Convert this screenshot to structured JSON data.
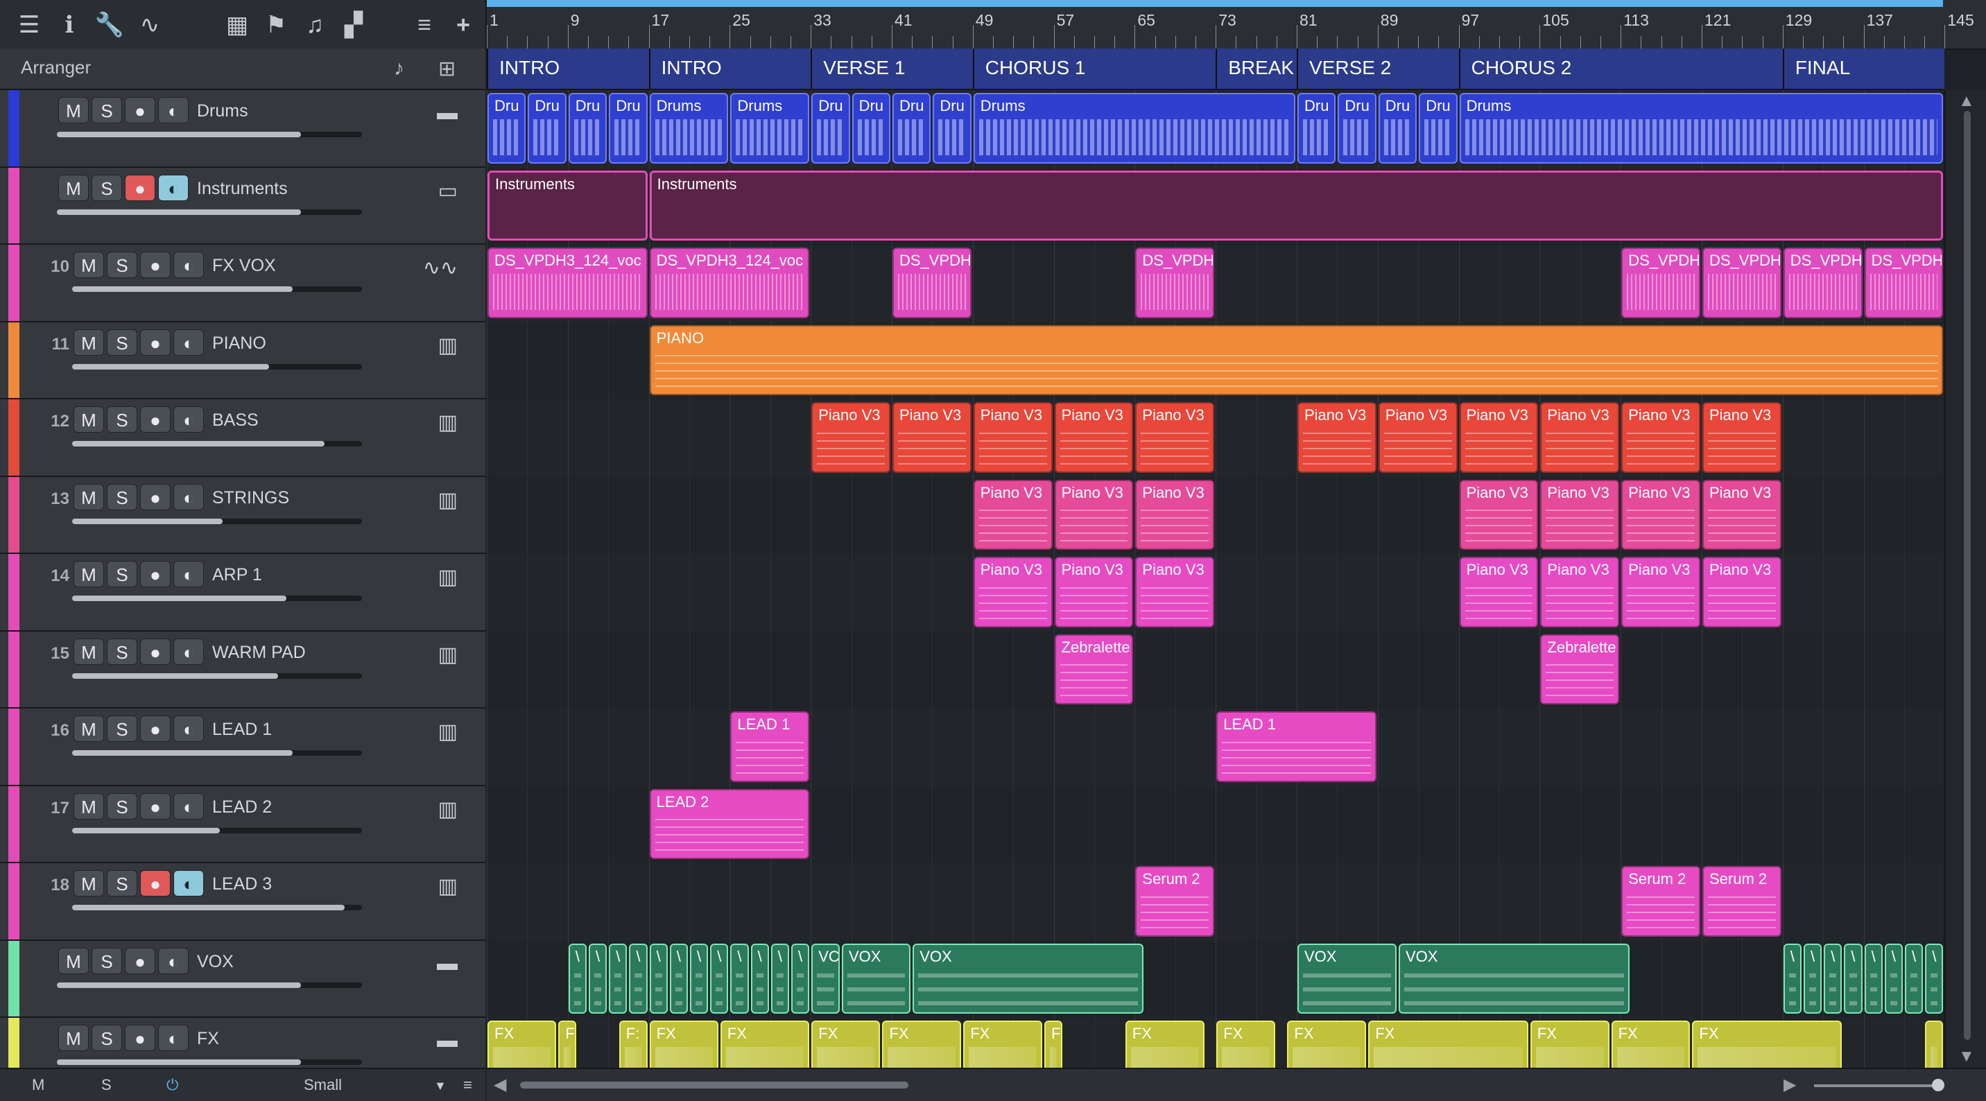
{
  "toolbar": {
    "icons": [
      "menu-icon",
      "info-icon",
      "wrench-icon",
      "automation-icon",
      "grid-icon",
      "flag-icon",
      "score-icon",
      "layout-icon",
      "list-icon",
      "add-icon"
    ]
  },
  "arranger": {
    "title": "Arranger"
  },
  "tracks": [
    {
      "id": "drums",
      "number": "",
      "name": "Drums",
      "color": "#2b3ad6",
      "kind": "folder",
      "rec": false,
      "mon": false,
      "volume": 0.8,
      "icon": "folder-icon"
    },
    {
      "id": "instruments",
      "number": "",
      "name": "Instruments",
      "color": "#e64bb8",
      "kind": "folder",
      "rec": true,
      "mon": true,
      "volume": 0.8,
      "icon": "folder-open-icon"
    },
    {
      "id": "fx-vox",
      "number": "10",
      "name": "FX VOX",
      "color": "#e64bb8",
      "kind": "audio",
      "rec": false,
      "mon": false,
      "volume": 0.76,
      "icon": "waveform-icon"
    },
    {
      "id": "piano",
      "number": "11",
      "name": "PIANO",
      "color": "#f08a3a",
      "kind": "instrument",
      "rec": false,
      "mon": false,
      "volume": 0.68,
      "icon": "keyboard-icon"
    },
    {
      "id": "bass",
      "number": "12",
      "name": "BASS",
      "color": "#e34a3a",
      "kind": "instrument",
      "rec": false,
      "mon": false,
      "volume": 0.87,
      "icon": "keyboard-icon"
    },
    {
      "id": "strings",
      "number": "13",
      "name": "STRINGS",
      "color": "#e64b8f",
      "kind": "instrument",
      "rec": false,
      "mon": false,
      "volume": 0.52,
      "icon": "keyboard-icon"
    },
    {
      "id": "arp-1",
      "number": "14",
      "name": "ARP 1",
      "color": "#e64bb8",
      "kind": "instrument",
      "rec": false,
      "mon": false,
      "volume": 0.74,
      "icon": "keyboard-icon"
    },
    {
      "id": "warm-pad",
      "number": "15",
      "name": "WARM PAD",
      "color": "#e64bb8",
      "kind": "instrument",
      "rec": false,
      "mon": false,
      "volume": 0.71,
      "icon": "keyboard-icon"
    },
    {
      "id": "lead-1",
      "number": "16",
      "name": "LEAD 1",
      "color": "#e64bb8",
      "kind": "instrument",
      "rec": false,
      "mon": false,
      "volume": 0.76,
      "icon": "keyboard-icon"
    },
    {
      "id": "lead-2",
      "number": "17",
      "name": "LEAD 2",
      "color": "#e64bb8",
      "kind": "instrument",
      "rec": false,
      "mon": false,
      "volume": 0.51,
      "icon": "keyboard-icon"
    },
    {
      "id": "lead-3",
      "number": "18",
      "name": "LEAD 3",
      "color": "#e64bb8",
      "kind": "instrument",
      "rec": true,
      "mon": true,
      "volume": 0.94,
      "icon": "keyboard-icon"
    },
    {
      "id": "vox",
      "number": "",
      "name": "VOX",
      "color": "#6ee3a8",
      "kind": "folder",
      "rec": false,
      "mon": false,
      "volume": 0.8,
      "icon": "folder-icon"
    },
    {
      "id": "fx",
      "number": "",
      "name": "FX",
      "color": "#e3e85a",
      "kind": "folder",
      "rec": false,
      "mon": false,
      "volume": 0.8,
      "icon": "folder-icon"
    }
  ],
  "buttons": {
    "mute": "M",
    "solo": "S"
  },
  "bottom": {
    "mute": "M",
    "solo": "S",
    "size": "Small"
  },
  "ruler": {
    "bars": [
      "1",
      "9",
      "17",
      "25",
      "33",
      "41",
      "49",
      "57",
      "65",
      "73",
      "81",
      "89",
      "97",
      "105",
      "113",
      "121",
      "129",
      "137",
      "145"
    ]
  },
  "markers": [
    {
      "name": "INTRO",
      "start": 1,
      "end": 17
    },
    {
      "name": "INTRO",
      "start": 17,
      "end": 33
    },
    {
      "name": "VERSE 1",
      "start": 33,
      "end": 49
    },
    {
      "name": "CHORUS 1",
      "start": 49,
      "end": 73
    },
    {
      "name": "BREAK",
      "start": 73,
      "end": 81
    },
    {
      "name": "VERSE 2",
      "start": 81,
      "end": 97
    },
    {
      "name": "CHORUS 2",
      "start": 97,
      "end": 129
    },
    {
      "name": "FINAL",
      "start": 129,
      "end": 145
    }
  ],
  "clips": {
    "drums": [
      {
        "start": 1,
        "end": 5,
        "label": "Dru"
      },
      {
        "start": 5,
        "end": 9,
        "label": "Dru"
      },
      {
        "start": 9,
        "end": 13,
        "label": "Dru"
      },
      {
        "start": 13,
        "end": 17,
        "label": "Dru"
      },
      {
        "start": 17,
        "end": 25,
        "label": "Drums"
      },
      {
        "start": 25,
        "end": 33,
        "label": "Drums"
      },
      {
        "start": 33,
        "end": 37,
        "label": "Dru"
      },
      {
        "start": 37,
        "end": 41,
        "label": "Dru"
      },
      {
        "start": 41,
        "end": 45,
        "label": "Dru"
      },
      {
        "start": 45,
        "end": 49,
        "label": "Dru"
      },
      {
        "start": 49,
        "end": 81,
        "label": "Drums"
      },
      {
        "start": 81,
        "end": 85,
        "label": "Dru"
      },
      {
        "start": 85,
        "end": 89,
        "label": "Dru"
      },
      {
        "start": 89,
        "end": 93,
        "label": "Dru"
      },
      {
        "start": 93,
        "end": 97,
        "label": "Dru"
      },
      {
        "start": 97,
        "end": 145,
        "label": "Drums"
      }
    ],
    "instruments": [
      {
        "start": 1,
        "end": 17,
        "label": "Instruments"
      },
      {
        "start": 17,
        "end": 145,
        "label": "Instruments"
      }
    ],
    "fx-vox": [
      {
        "start": 1,
        "end": 17,
        "label": "DS_VPDH3_124_voc"
      },
      {
        "start": 17,
        "end": 33,
        "label": "DS_VPDH3_124_voc"
      },
      {
        "start": 41,
        "end": 49,
        "label": "DS_VPDH"
      },
      {
        "start": 65,
        "end": 73,
        "label": "DS_VPDH"
      },
      {
        "start": 113,
        "end": 121,
        "label": "DS_VPDH"
      },
      {
        "start": 121,
        "end": 129,
        "label": "DS_VPDH"
      },
      {
        "start": 129,
        "end": 137,
        "label": "DS_VPDH"
      },
      {
        "start": 137,
        "end": 145,
        "label": "DS_VPDH"
      }
    ],
    "piano": [
      {
        "start": 17,
        "end": 145,
        "label": "PIANO"
      }
    ],
    "bass": [
      {
        "start": 33,
        "end": 41,
        "label": "Piano V3"
      },
      {
        "start": 41,
        "end": 49,
        "label": "Piano V3"
      },
      {
        "start": 49,
        "end": 57,
        "label": "Piano V3"
      },
      {
        "start": 57,
        "end": 65,
        "label": "Piano V3"
      },
      {
        "start": 65,
        "end": 73,
        "label": "Piano V3"
      },
      {
        "start": 81,
        "end": 89,
        "label": "Piano V3"
      },
      {
        "start": 89,
        "end": 97,
        "label": "Piano V3"
      },
      {
        "start": 97,
        "end": 105,
        "label": "Piano V3"
      },
      {
        "start": 105,
        "end": 113,
        "label": "Piano V3"
      },
      {
        "start": 113,
        "end": 121,
        "label": "Piano V3"
      },
      {
        "start": 121,
        "end": 129,
        "label": "Piano V3"
      }
    ],
    "strings": [
      {
        "start": 49,
        "end": 57,
        "label": "Piano V3"
      },
      {
        "start": 57,
        "end": 65,
        "label": "Piano V3"
      },
      {
        "start": 65,
        "end": 73,
        "label": "Piano V3"
      },
      {
        "start": 97,
        "end": 105,
        "label": "Piano V3"
      },
      {
        "start": 105,
        "end": 113,
        "label": "Piano V3"
      },
      {
        "start": 113,
        "end": 121,
        "label": "Piano V3"
      },
      {
        "start": 121,
        "end": 129,
        "label": "Piano V3"
      }
    ],
    "arp-1": [
      {
        "start": 49,
        "end": 57,
        "label": "Piano V3"
      },
      {
        "start": 57,
        "end": 65,
        "label": "Piano V3"
      },
      {
        "start": 65,
        "end": 73,
        "label": "Piano V3"
      },
      {
        "start": 97,
        "end": 105,
        "label": "Piano V3"
      },
      {
        "start": 105,
        "end": 113,
        "label": "Piano V3"
      },
      {
        "start": 113,
        "end": 121,
        "label": "Piano V3"
      },
      {
        "start": 121,
        "end": 129,
        "label": "Piano V3"
      }
    ],
    "warm-pad": [
      {
        "start": 57,
        "end": 65,
        "label": "Zebralette"
      },
      {
        "start": 105,
        "end": 113,
        "label": "Zebralette"
      }
    ],
    "lead-1": [
      {
        "start": 25,
        "end": 33,
        "label": "LEAD 1"
      },
      {
        "start": 73,
        "end": 89,
        "label": "LEAD 1"
      }
    ],
    "lead-2": [
      {
        "start": 17,
        "end": 33,
        "label": "LEAD 2"
      }
    ],
    "lead-3": [
      {
        "start": 65,
        "end": 73,
        "label": "Serum 2"
      },
      {
        "start": 113,
        "end": 121,
        "label": "Serum 2"
      },
      {
        "start": 121,
        "end": 129,
        "label": "Serum 2"
      }
    ],
    "vox": [
      {
        "start": 9,
        "end": 11,
        "label": "\\"
      },
      {
        "start": 11,
        "end": 13,
        "label": "\\"
      },
      {
        "start": 13,
        "end": 15,
        "label": "\\"
      },
      {
        "start": 15,
        "end": 17,
        "label": "\\"
      },
      {
        "start": 17,
        "end": 19,
        "label": "\\"
      },
      {
        "start": 19,
        "end": 21,
        "label": "\\"
      },
      {
        "start": 21,
        "end": 23,
        "label": "\\"
      },
      {
        "start": 23,
        "end": 25,
        "label": "\\"
      },
      {
        "start": 25,
        "end": 27,
        "label": "\\"
      },
      {
        "start": 27,
        "end": 29,
        "label": "\\"
      },
      {
        "start": 29,
        "end": 31,
        "label": "\\"
      },
      {
        "start": 31,
        "end": 33,
        "label": "\\"
      },
      {
        "start": 33,
        "end": 36,
        "label": "VC"
      },
      {
        "start": 36,
        "end": 43,
        "label": "VOX"
      },
      {
        "start": 43,
        "end": 66,
        "label": "VOX"
      },
      {
        "start": 81,
        "end": 91,
        "label": "VOX"
      },
      {
        "start": 91,
        "end": 114,
        "label": "VOX"
      },
      {
        "start": 129,
        "end": 131,
        "label": "\\"
      },
      {
        "start": 131,
        "end": 133,
        "label": "\\"
      },
      {
        "start": 133,
        "end": 135,
        "label": "\\"
      },
      {
        "start": 135,
        "end": 137,
        "label": "\\"
      },
      {
        "start": 137,
        "end": 139,
        "label": "\\"
      },
      {
        "start": 139,
        "end": 141,
        "label": "\\"
      },
      {
        "start": 141,
        "end": 143,
        "label": "\\"
      },
      {
        "start": 143,
        "end": 145,
        "label": "\\"
      }
    ],
    "fx": [
      {
        "start": 1,
        "end": 8,
        "label": "FX"
      },
      {
        "start": 8,
        "end": 10,
        "label": "F"
      },
      {
        "start": 14,
        "end": 17,
        "label": "F:"
      },
      {
        "start": 17,
        "end": 24,
        "label": "FX"
      },
      {
        "start": 24,
        "end": 33,
        "label": "FX"
      },
      {
        "start": 33,
        "end": 40,
        "label": "FX"
      },
      {
        "start": 40,
        "end": 48,
        "label": "FX"
      },
      {
        "start": 48,
        "end": 56,
        "label": "FX"
      },
      {
        "start": 56,
        "end": 58,
        "label": "F"
      },
      {
        "start": 64,
        "end": 72,
        "label": "FX"
      },
      {
        "start": 73,
        "end": 79,
        "label": "FX"
      },
      {
        "start": 80,
        "end": 88,
        "label": "FX"
      },
      {
        "start": 88,
        "end": 104,
        "label": "FX"
      },
      {
        "start": 104,
        "end": 112,
        "label": "FX"
      },
      {
        "start": 112,
        "end": 120,
        "label": "FX"
      },
      {
        "start": 120,
        "end": 135,
        "label": "FX"
      },
      {
        "start": 143,
        "end": 145,
        "label": ""
      }
    ]
  },
  "colors": {
    "drums": "#2f3fd0",
    "instruments": "#5a2348",
    "fx-vox": "#e04cc0",
    "piano": "#f08a3a",
    "bass": "#e8473a",
    "strings": "#e64b9a",
    "arp-1": "#e64bc4",
    "warm-pad": "#e64bc4",
    "lead-1": "#e64bc4",
    "lead-2": "#e64bc4",
    "lead-3": "#e64bc4",
    "vox": "#2c7a5e",
    "fx": "#bfc23a"
  }
}
